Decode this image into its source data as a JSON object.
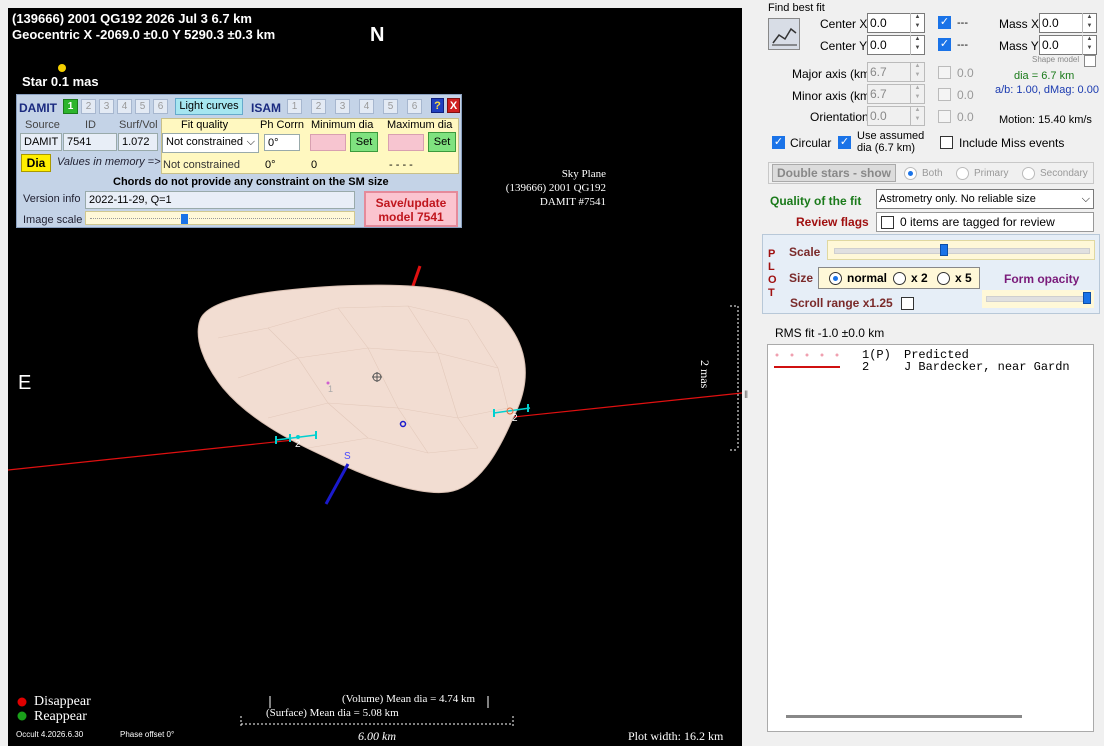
{
  "plot": {
    "title_line1": "(139666) 2001 QG192  2026 Jul 3   6.7 km",
    "title_line2": "Geocentric  X  -2069.0 ±0.0  Y 5290.3 ±0.3 km",
    "north_label": "N",
    "east_label": "E",
    "star_label": "Star 0.1 mas",
    "sky_plane": {
      "line1": "Sky Plane",
      "line2": "(139666) 2001 QG192",
      "line3": "DAMIT #7541"
    },
    "scale_bar_label": "2 mas",
    "chord_labels": [
      "1",
      "2",
      "2"
    ],
    "pole_label": "S",
    "legend": {
      "disappear": "Disappear",
      "reappear": "Reappear",
      "disappear_color": "#e00000",
      "reappear_color": "#1aa01a"
    },
    "volume_dia": "(Volume) Mean dia = 4.74 km",
    "surface_dia": "(Surface) Mean dia = 5.08 km",
    "scale_km": "6.00 km",
    "version": "Occult 4.2026.6.30",
    "phase_offset": "Phase offset 0°",
    "plot_width": "Plot width: 16.2 km"
  },
  "damit": {
    "title": "DAMIT",
    "numbers": [
      "1",
      "2",
      "3",
      "4",
      "5",
      "6"
    ],
    "light_curves": "Light curves",
    "isam_title": "ISAM",
    "isam_numbers": [
      "1",
      "2",
      "3",
      "4",
      "5",
      "6"
    ],
    "help_icon": "?",
    "close_icon": "X",
    "col_source": "Source",
    "col_id": "ID",
    "col_surfvol": "Surf/Vol",
    "source_value": "DAMIT",
    "id_value": "7541",
    "surfvol_value": "1.072",
    "dia_button": "Dia",
    "values_in_memory": "Values in memory =>",
    "fit_quality_label": "Fit quality",
    "fit_quality_value": "Not constrained",
    "fit_quality_memory": "Not constrained",
    "ph_corr_label": "Ph Corrn",
    "ph_corr_value": "0°",
    "ph_corr_memory": "0°",
    "min_dia_label": "Minimum dia",
    "min_dia_memory": "0",
    "max_dia_label": "Maximum dia",
    "max_dia_memory": "- - - -",
    "set_label": "Set",
    "chords_note": "Chords do not provide any constraint on the SM size",
    "version_label": "Version info",
    "version_value": "2022-11-29, Q=1",
    "image_scale_label": "Image scale",
    "save_button": "Save/update\nmodel 7541"
  },
  "fit": {
    "find_best_fit": "Find best fit",
    "center_x_label": "Center X",
    "center_x": "0.0",
    "center_y_label": "Center Y",
    "center_y": "0.0",
    "mass_x_label": "Mass X",
    "mass_x": "0.0",
    "mass_y_label": "Mass Y",
    "mass_y": "0.0",
    "dash": "---",
    "shape_model": "Shape model",
    "major_axis_label": "Major axis (km)",
    "major_axis": "6.7",
    "minor_axis_label": "Minor axis (km)",
    "minor_axis": "6.7",
    "orientation_label": "Orientation",
    "orientation": "0.0",
    "zero": "0.0",
    "dia_text": "dia = 6.7 km",
    "ab_text": "a/b: 1.00, dMag: 0.00",
    "motion_text": "Motion: 15.40 km/s",
    "circular_label": "Circular",
    "use_assumed_label": "Use assumed\ndia (6.7 km)",
    "include_miss_label": "Include Miss events",
    "double_stars_label": "Double stars - show",
    "both_label": "Both",
    "primary_label": "Primary",
    "secondary_label": "Secondary",
    "quality_label": "Quality of the fit",
    "quality_value": "Astrometry only. No reliable size",
    "review_flags_label": "Review flags",
    "review_flags_text": "0 items are tagged for review"
  },
  "plot_controls": {
    "side_label": "PLOT",
    "scale_label": "Scale",
    "size_label": "Size",
    "size_normal": "normal",
    "size_x2": "x 2",
    "size_x5": "x 5",
    "form_opacity": "Form opacity",
    "scroll_range": "Scroll range x1.25"
  },
  "rms": {
    "label": "RMS fit -1.0 ±0.0 km",
    "rows": [
      {
        "num": "1(P)",
        "name": "Predicted"
      },
      {
        "num": "2",
        "name": "J Bardecker, near Gardn"
      }
    ]
  }
}
